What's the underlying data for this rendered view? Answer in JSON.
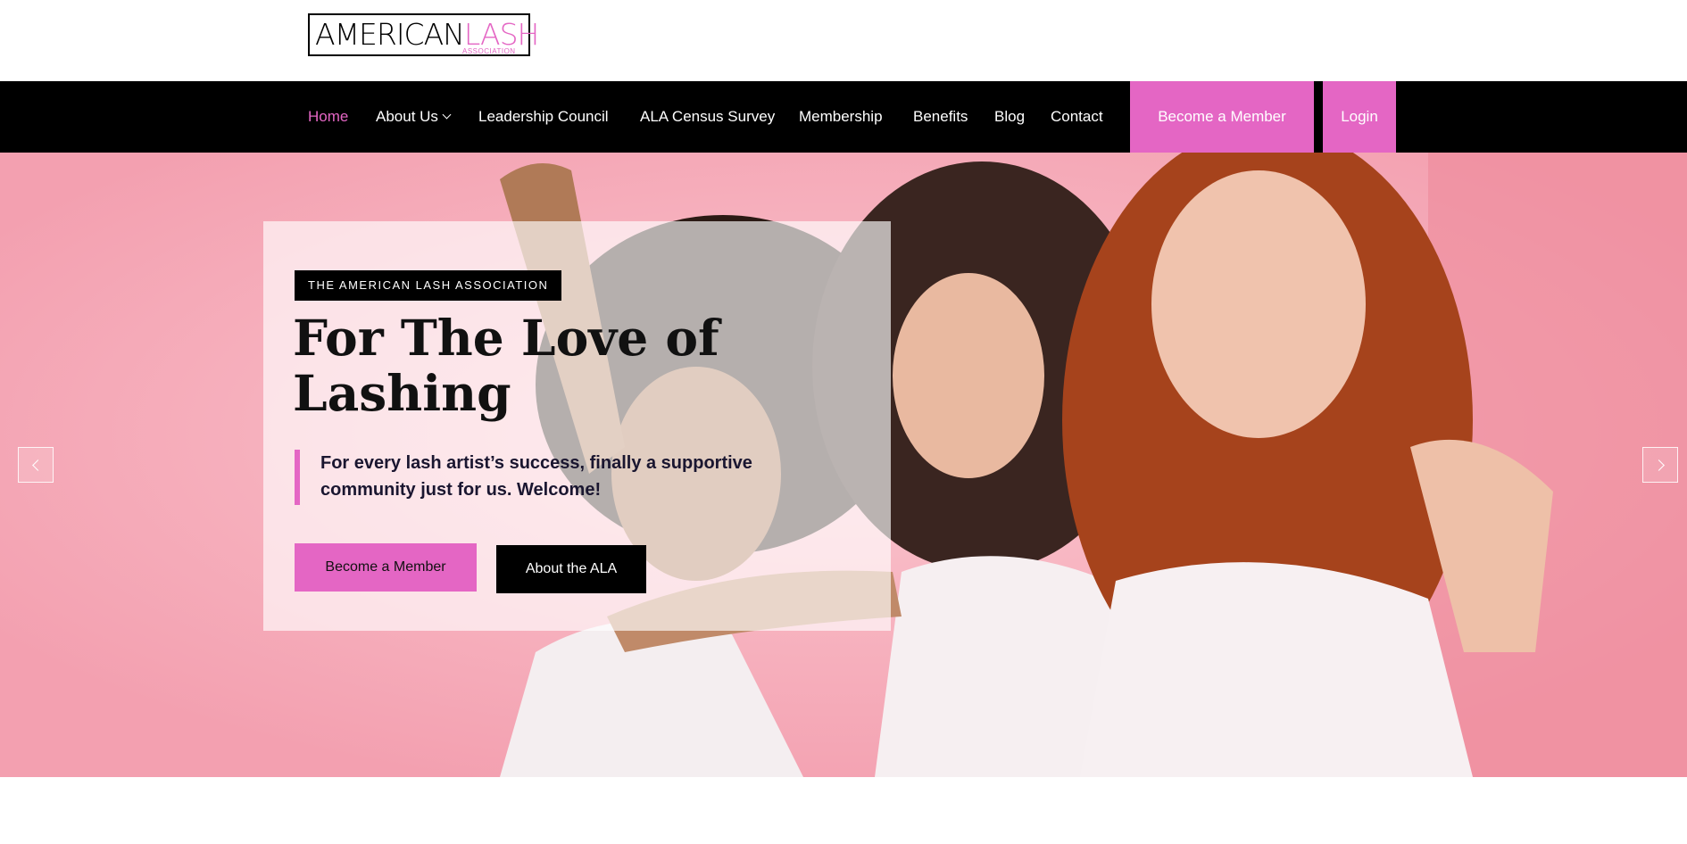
{
  "logo": {
    "main": "AMERICAN",
    "accent": "LASH",
    "sub": "ASSOCIATION"
  },
  "nav": {
    "items": [
      {
        "label": "Home",
        "active": true
      },
      {
        "label": "About Us",
        "has_dropdown": true
      },
      {
        "label": "Leadership Council"
      },
      {
        "label": "ALA Census Survey"
      },
      {
        "label": "Membership"
      },
      {
        "label": "Benefits"
      },
      {
        "label": "Blog"
      },
      {
        "label": "Contact"
      }
    ],
    "cta_label": "Become a Member",
    "login_label": "Login"
  },
  "hero": {
    "eyebrow": "THE AMERICAN LASH ASSOCIATION",
    "title": "For The Love of Lashing",
    "quote": "For every lash artist’s success, finally a supportive community just for us. Welcome!",
    "primary_button": "Become a Member",
    "secondary_button": "About the ALA",
    "prev_icon": "chevron-left-icon",
    "next_icon": "chevron-right-icon"
  },
  "colors": {
    "accent": "#e466c4",
    "nav_bg": "#000000",
    "hero_bg": "#f7a5b4"
  }
}
